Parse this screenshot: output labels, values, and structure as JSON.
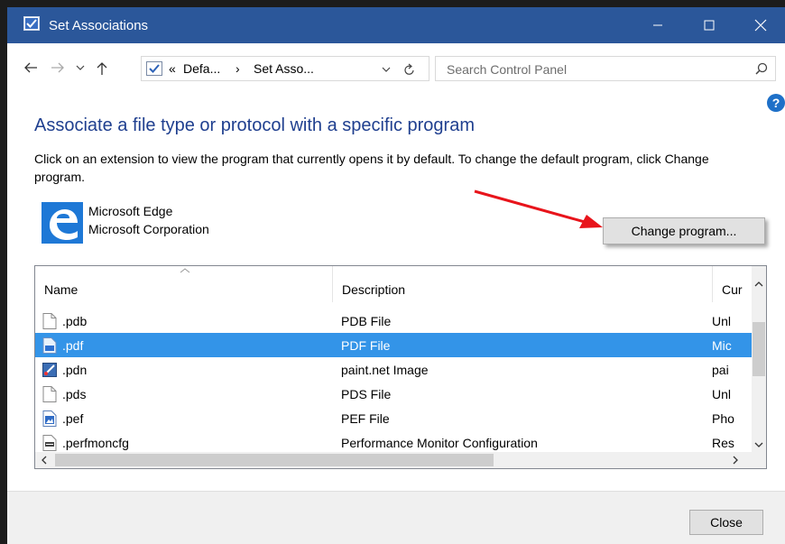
{
  "window": {
    "title": "Set Associations",
    "controls": {
      "minimize": "minimize",
      "maximize": "maximize",
      "close": "close"
    }
  },
  "addressbar": {
    "breadcrumb": {
      "overflow": "«",
      "segment1": "Defa...",
      "separator": "›",
      "segment2": "Set Asso..."
    },
    "search_placeholder": "Search Control Panel"
  },
  "help": {
    "label": "?"
  },
  "main": {
    "heading": "Associate a file type or protocol with a specific program",
    "description": "Click on an extension to view the program that currently opens it by default. To change the default program, click Change program."
  },
  "program": {
    "name": "Microsoft Edge",
    "company": "Microsoft Corporation",
    "change_button": "Change program..."
  },
  "list": {
    "columns": {
      "name": "Name",
      "description": "Description",
      "current": "Cur"
    },
    "rows": [
      {
        "name": ".pdb",
        "description": "PDB File",
        "current": "Unl",
        "icon": "blank-file-icon",
        "selected": false
      },
      {
        "name": ".pdf",
        "description": "PDF File",
        "current": "Mic",
        "icon": "pdf-file-icon",
        "selected": true
      },
      {
        "name": ".pdn",
        "description": "paint.net Image",
        "current": "pai",
        "icon": "paintnet-icon",
        "selected": false
      },
      {
        "name": ".pds",
        "description": "PDS File",
        "current": "Unl",
        "icon": "blank-file-icon",
        "selected": false
      },
      {
        "name": ".pef",
        "description": "PEF File",
        "current": "Pho",
        "icon": "photo-file-icon",
        "selected": false
      },
      {
        "name": ".perfmoncfg",
        "description": "Performance Monitor Configuration",
        "current": "Res",
        "icon": "perfmon-icon",
        "selected": false
      }
    ]
  },
  "footer": {
    "close_button": "Close"
  },
  "colors": {
    "titlebar": "#2b579a",
    "selection": "#3394e8",
    "heading": "#1f3f8f",
    "annotation_arrow": "#e8141b"
  }
}
